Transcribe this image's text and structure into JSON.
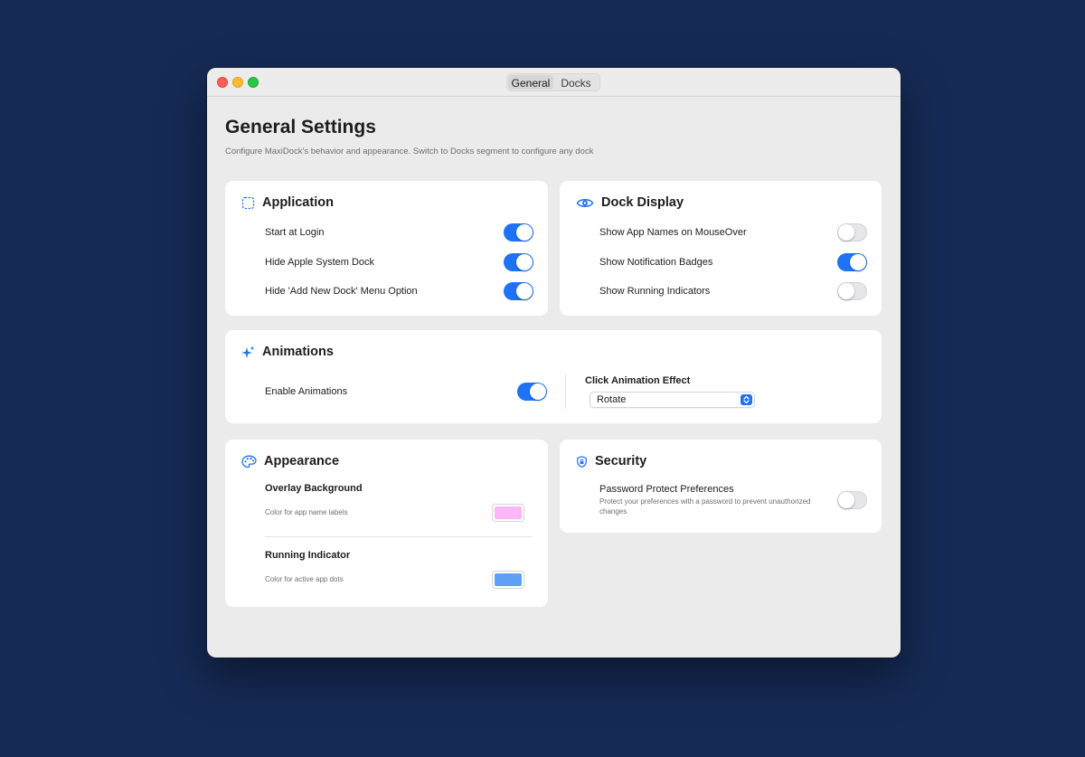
{
  "window": {
    "tabs": [
      {
        "label": "General",
        "selected": true
      },
      {
        "label": "Docks",
        "selected": false
      }
    ]
  },
  "page": {
    "title": "General Settings",
    "subtitle": "Configure MaxiDock's behavior and appearance. Switch to Docks segment to configure any dock"
  },
  "application": {
    "title": "Application",
    "icon": "dashed-square-icon",
    "items": [
      {
        "label": "Start at Login",
        "on": true
      },
      {
        "label": "Hide Apple System Dock",
        "on": true
      },
      {
        "label": "Hide 'Add New Dock' Menu Option",
        "on": true
      }
    ]
  },
  "dock_display": {
    "title": "Dock Display",
    "icon": "eye-icon",
    "items": [
      {
        "label": "Show App Names on MouseOver",
        "on": false
      },
      {
        "label": "Show Notification Badges",
        "on": true
      },
      {
        "label": "Show Running Indicators",
        "on": false
      }
    ]
  },
  "animations": {
    "title": "Animations",
    "icon": "sparkles-icon",
    "enable_label": "Enable Animations",
    "enable_on": true,
    "effect_label": "Click Animation Effect",
    "effect_value": "Rotate"
  },
  "appearance": {
    "title": "Appearance",
    "icon": "palette-icon",
    "overlay": {
      "title": "Overlay Background",
      "desc": "Color for app name labels",
      "color": "#fbb6f8"
    },
    "running": {
      "title": "Running Indicator",
      "desc": "Color for active app dots",
      "color": "#5f9ff5"
    }
  },
  "security": {
    "title": "Security",
    "icon": "shield-lock-icon",
    "password_label": "Password Protect Preferences",
    "password_desc": "Protect your preferences with a password to prevent unauthorized changes",
    "password_on": false
  },
  "colors": {
    "accent": "#1d72f5",
    "background": "#152a55"
  }
}
